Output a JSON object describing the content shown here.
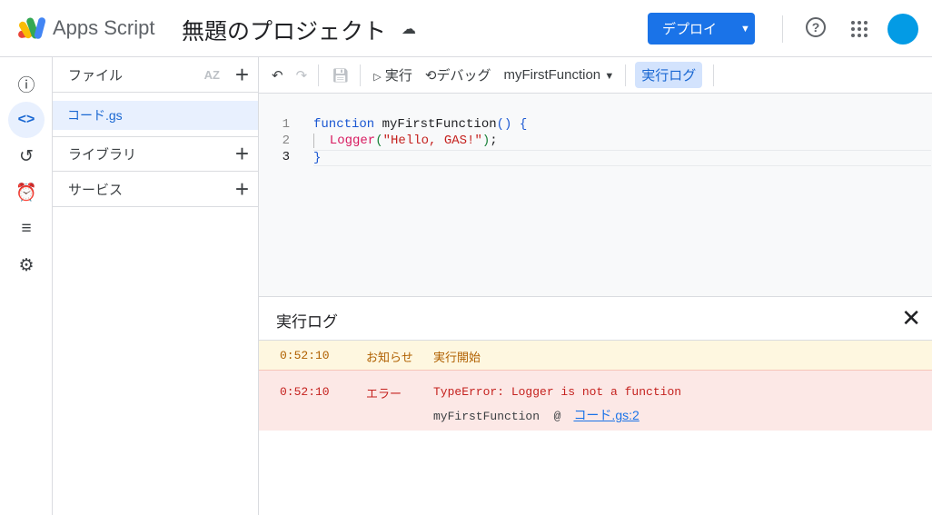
{
  "header": {
    "app_name": "Apps Script",
    "project_title": "無題のプロジェクト",
    "deploy_label": "デプロイ",
    "help_icon": "?"
  },
  "files": {
    "title": "ファイル",
    "sort_label": "AZ",
    "items": [
      {
        "label": "コード.gs"
      }
    ],
    "libraries": "ライブラリ",
    "services": "サービス"
  },
  "toolbar": {
    "run": "実行",
    "debug": "デバッグ",
    "function_select": "myFirstFunction",
    "log_button": "実行ログ"
  },
  "editor": {
    "line_numbers": [
      "1",
      "2",
      "3"
    ],
    "lines": {
      "l1_kw": "function",
      "l1_name": " myFirstFunction",
      "l1_paren": "()",
      "l1_brace": " {",
      "l2_fn": "  Logger",
      "l2_open": "(",
      "l2_str": "\"Hello, GAS!\"",
      "l2_close": ")",
      "l2_end": ";",
      "l3": "}"
    }
  },
  "log": {
    "title": "実行ログ",
    "rows": [
      {
        "time": "0:52:10",
        "level": "お知らせ",
        "message": "実行開始"
      },
      {
        "time": "0:52:10",
        "level": "エラー",
        "message": "TypeError: Logger is not a function",
        "stack_fn": "myFirstFunction  @",
        "stack_link": "コード.gs:2"
      }
    ]
  },
  "colors": {
    "accent": "#1a73e8",
    "info_bg": "#fef7e0",
    "error_bg": "#fce8e6"
  }
}
